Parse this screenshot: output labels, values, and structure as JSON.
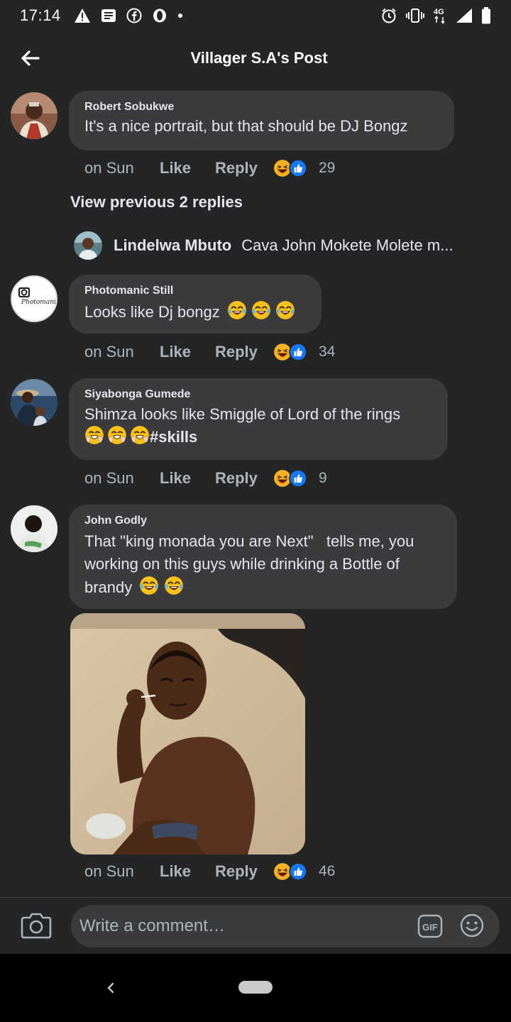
{
  "status_bar": {
    "time": "17:14",
    "network": "4G"
  },
  "header": {
    "title": "Villager S.A's Post"
  },
  "comments": [
    {
      "name": "Robert Sobukwe",
      "text": "It's a nice portrait, but that should be DJ Bongz",
      "time": "on Sun",
      "like": "Like",
      "reply": "Reply",
      "reactions": "29"
    },
    {
      "name": "Photomanic Still",
      "text": "Looks like Dj bongz",
      "time": "on Sun",
      "like": "Like",
      "reply": "Reply",
      "reactions": "34"
    },
    {
      "name": "Siyabonga Gumede",
      "text_line1": "Shimza looks like Smiggle of Lord of the rings",
      "hashtag": "#skills",
      "time": "on Sun",
      "like": "Like",
      "reply": "Reply",
      "reactions": "9"
    },
    {
      "name": "John Godly",
      "text_line1": "That \"king monada you are Next\"   tells me, you",
      "text_line2": "working on this guys while drinking a Bottle of",
      "text_line3": "brandy",
      "time": "on Sun",
      "like": "Like",
      "reply": "Reply",
      "reactions": "46"
    }
  ],
  "view_previous": "View previous 2 replies",
  "reply_preview": {
    "name": "Lindelwa Mbuto",
    "text": "Cava John Mokete Molete m..."
  },
  "avatar_logo_text": "Photomanic",
  "composer": {
    "placeholder": "Write a comment…",
    "gif_label": "GIF"
  },
  "colors": {
    "background": "#242527",
    "bubble": "#3a3b3c",
    "like_blue": "#1877f2",
    "haha_yellow": "#f7b125"
  },
  "icons": [
    "back-arrow-icon",
    "camera-icon",
    "gif-icon",
    "emoji-icon",
    "haha-reaction-icon",
    "like-reaction-icon",
    "laughing-emoji-icon",
    "hot-face-emoji-icon"
  ]
}
